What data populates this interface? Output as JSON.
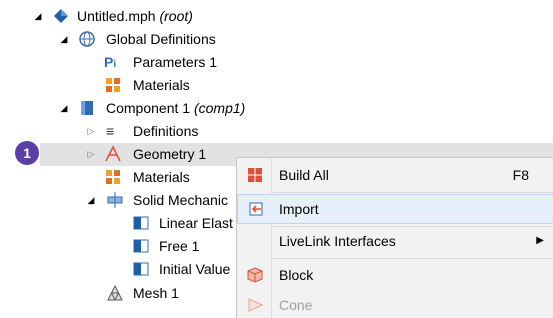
{
  "tree": [
    {
      "id": "root",
      "label": "Untitled.mph",
      "suffix": "(root)"
    },
    {
      "id": "global",
      "label": "Global Definitions",
      "suffix": ""
    },
    {
      "id": "params",
      "label": "Parameters 1",
      "suffix": ""
    },
    {
      "id": "materials-global",
      "label": "Materials",
      "suffix": ""
    },
    {
      "id": "component",
      "label": "Component 1",
      "suffix": "(comp1)"
    },
    {
      "id": "definitions",
      "label": "Definitions",
      "suffix": ""
    },
    {
      "id": "geometry",
      "label": "Geometry 1",
      "suffix": ""
    },
    {
      "id": "materials-comp",
      "label": "Materials",
      "suffix": ""
    },
    {
      "id": "solid",
      "label": "Solid Mechanic",
      "suffix": ""
    },
    {
      "id": "linear",
      "label": "Linear Elast",
      "suffix": ""
    },
    {
      "id": "free",
      "label": "Free 1",
      "suffix": ""
    },
    {
      "id": "initial",
      "label": "Initial Value",
      "suffix": ""
    },
    {
      "id": "mesh",
      "label": "Mesh 1",
      "suffix": ""
    }
  ],
  "step_marker": "1",
  "context_menu": {
    "items": [
      {
        "label": "Build All",
        "shortcut": "F8"
      },
      {
        "label": "Import",
        "shortcut": ""
      },
      {
        "label": "LiveLink Interfaces",
        "shortcut": ""
      },
      {
        "label": "Block",
        "shortcut": ""
      },
      {
        "label": "Cone",
        "shortcut": ""
      }
    ],
    "submenu_arrow": "▶"
  },
  "colors": {
    "selection": "#e2e2e2",
    "menu_bg": "#f2f2f2",
    "hover": "#e6f0fa",
    "marker": "#5a3fa6"
  }
}
